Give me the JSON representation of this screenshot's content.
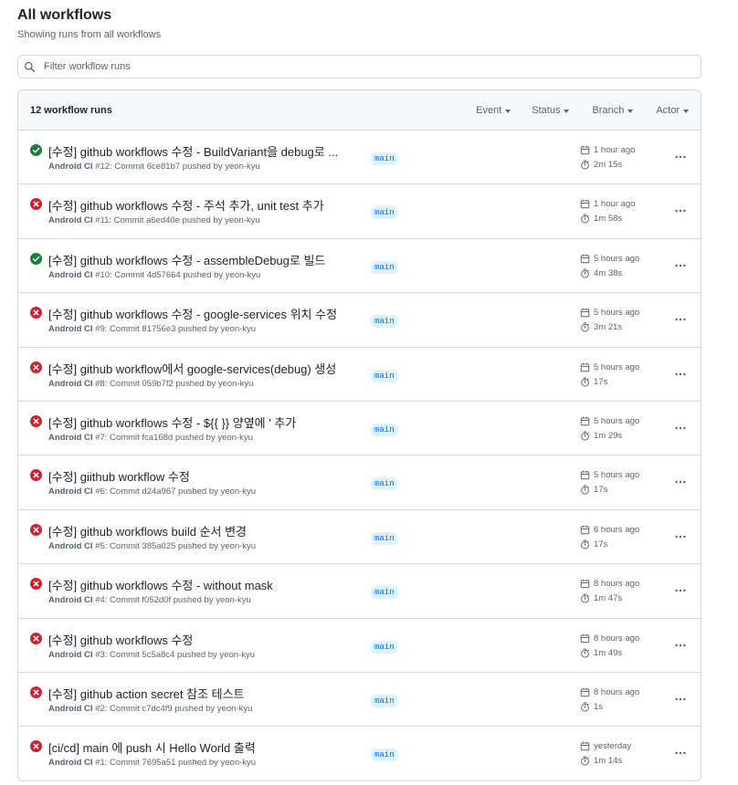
{
  "header": {
    "title": "All workflows",
    "subtitle": "Showing runs from all workflows"
  },
  "search": {
    "placeholder": "Filter workflow runs",
    "value": ""
  },
  "list": {
    "count_label": "12 workflow runs",
    "filters": [
      {
        "label": "Event"
      },
      {
        "label": "Status"
      },
      {
        "label": "Branch"
      },
      {
        "label": "Actor"
      }
    ]
  },
  "colors": {
    "success": "#1a7f37",
    "failure": "#cf222e",
    "accent": "#0969da"
  },
  "runs": [
    {
      "status": "success",
      "title": "[수정] github workflows 수정 - BuildVariant을 debug로 ...",
      "workflow": "Android CI",
      "meta": " #12: Commit 6ce81b7 pushed by yeon-kyu",
      "branch": "main",
      "time": "1 hour ago",
      "duration": "2m 15s"
    },
    {
      "status": "failure",
      "title": "[수정] github workflows 수정 - 주석 추가, unit test 추가",
      "workflow": "Android CI",
      "meta": " #11: Commit a6ed40e pushed by yeon-kyu",
      "branch": "main",
      "time": "1 hour ago",
      "duration": "1m 58s"
    },
    {
      "status": "success",
      "title": "[수정] github workflows 수정 - assembleDebug로 빌드",
      "workflow": "Android CI",
      "meta": " #10: Commit 4d57664 pushed by yeon-kyu",
      "branch": "main",
      "time": "5 hours ago",
      "duration": "4m 38s"
    },
    {
      "status": "failure",
      "title": "[수정] github workflows 수정 - google-services 위치 수정",
      "workflow": "Android CI",
      "meta": " #9: Commit 81756e3 pushed by yeon-kyu",
      "branch": "main",
      "time": "5 hours ago",
      "duration": "3m 21s"
    },
    {
      "status": "failure",
      "title": "[수정] github workflow에서 google-services(debug) 생성",
      "workflow": "Android CI",
      "meta": " #8: Commit 059b7f2 pushed by yeon-kyu",
      "branch": "main",
      "time": "5 hours ago",
      "duration": "17s"
    },
    {
      "status": "failure",
      "title": "[수정] github workflows 수정 - ${{ }} 양옆에 ' 추가",
      "workflow": "Android CI",
      "meta": " #7: Commit fca168d pushed by yeon-kyu",
      "branch": "main",
      "time": "5 hours ago",
      "duration": "1m 29s"
    },
    {
      "status": "failure",
      "title": "[수정] giithub workflow 수정",
      "workflow": "Android CI",
      "meta": " #6: Commit d24a967 pushed by yeon-kyu",
      "branch": "main",
      "time": "5 hours ago",
      "duration": "17s"
    },
    {
      "status": "failure",
      "title": "[수정] github workflows build 순서 변경",
      "workflow": "Android CI",
      "meta": " #5: Commit 385a025 pushed by yeon-kyu",
      "branch": "main",
      "time": "6 hours ago",
      "duration": "17s"
    },
    {
      "status": "failure",
      "title": "[수정] github workflows 수정 - without mask",
      "workflow": "Android CI",
      "meta": " #4: Commit f052d0f pushed by yeon-kyu",
      "branch": "main",
      "time": "8 hours ago",
      "duration": "1m 47s"
    },
    {
      "status": "failure",
      "title": "[수정] github workflows 수정",
      "workflow": "Android CI",
      "meta": " #3: Commit 5c5a8c4 pushed by yeon-kyu",
      "branch": "main",
      "time": "8 hours ago",
      "duration": "1m 49s"
    },
    {
      "status": "failure",
      "title": "[수정] github action secret 참조 테스트",
      "workflow": "Android CI",
      "meta": " #2: Commit c7dc4f9 pushed by yeon-kyu",
      "branch": "main",
      "time": "8 hours ago",
      "duration": "1s"
    },
    {
      "status": "failure",
      "title": "[ci/cd] main 에 push 시 Hello World 출력",
      "workflow": "Android CI",
      "meta": " #1: Commit 7695a51 pushed by yeon-kyu",
      "branch": "main",
      "time": "yesterday",
      "duration": "1m 14s"
    }
  ]
}
